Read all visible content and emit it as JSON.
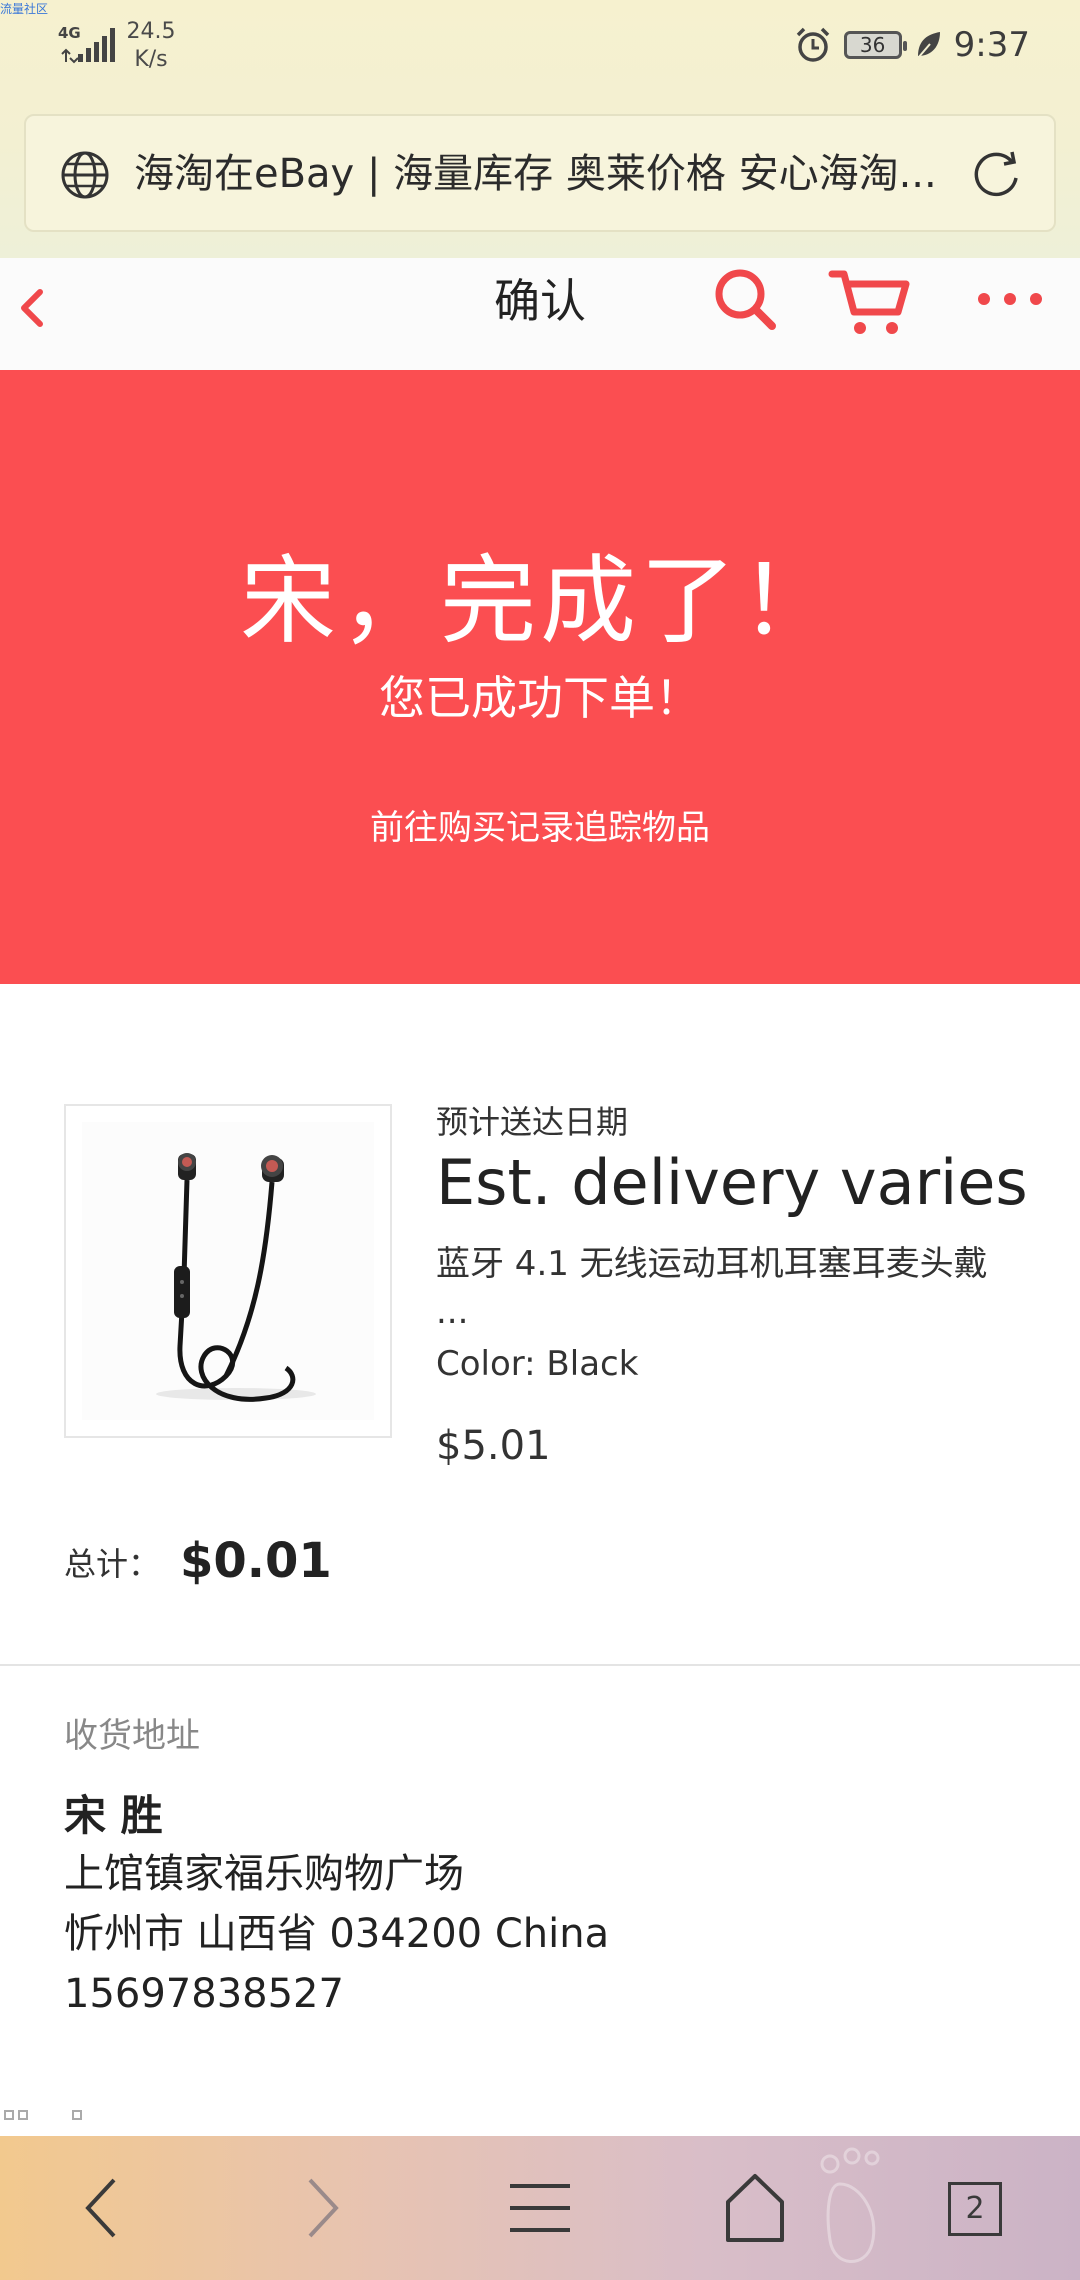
{
  "status_bar": {
    "watermark": "流量社区",
    "network_type": "4G",
    "speed_value": "24.5",
    "speed_unit": "K/s",
    "battery_level": "36",
    "time": "9:37"
  },
  "browser": {
    "url_title": "海淘在eBay | 海量库存 奥莱价格 安心海淘...",
    "icons": {
      "globe": "globe-icon",
      "refresh": "refresh-icon"
    }
  },
  "header": {
    "title": "确认",
    "icons": {
      "back": "chevron-left-icon",
      "search": "search-icon",
      "cart": "cart-icon",
      "more": "more-horizontal-icon"
    },
    "accent_color": "#f0484b"
  },
  "hero": {
    "title": "宋，完成了！",
    "subtitle": "您已成功下单！",
    "link": "前往购买记录追踪物品",
    "background_color": "#fb4e51"
  },
  "order": {
    "est_label": "预计送达日期",
    "est_value": "Est. delivery varies",
    "product_title": "蓝牙 4.1 无线运动耳机耳塞耳麦头戴",
    "product_title_ellipsis": "...",
    "color": "Color: Black",
    "price": "$5.01",
    "total_label": "总计：",
    "total_value": "$0.01"
  },
  "address": {
    "heading": "收货地址",
    "name": "宋 胜",
    "line1": "上馆镇家福乐购物广场",
    "line2": "忻州市 山西省 034200 China",
    "phone": "15697838527"
  },
  "bottom_nav": {
    "tab_count": "2",
    "icons": {
      "back": "chevron-left-icon",
      "forward": "chevron-right-icon",
      "menu": "menu-icon",
      "home": "home-icon",
      "tabs": "tabs-icon"
    }
  }
}
